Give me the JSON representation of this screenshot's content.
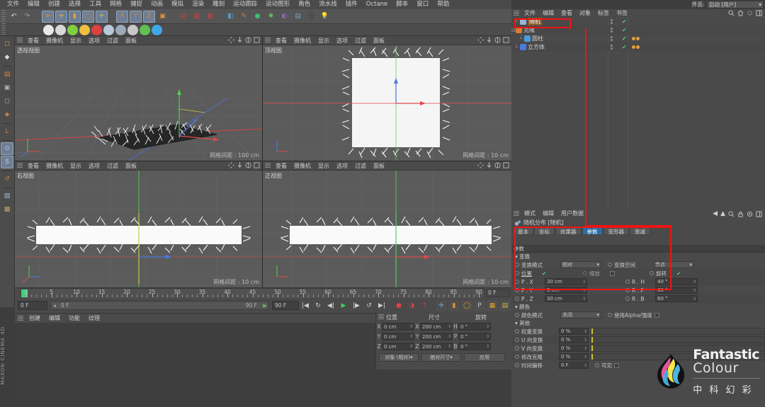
{
  "app": {
    "name": "CINEMA 4D",
    "brand_side": "MAXON CINEMA 4D"
  },
  "menubar": {
    "items": [
      "文件",
      "编辑",
      "创建",
      "选择",
      "工具",
      "网格",
      "捕捉",
      "动画",
      "模拟",
      "渲染",
      "雕刻",
      "运动跟踪",
      "运动图形",
      "角色",
      "流水线",
      "插件",
      "Octane",
      "脚本",
      "窗口",
      "帮助"
    ]
  },
  "layout_selector": {
    "label": "界面:",
    "value": "启动 [用户]"
  },
  "toolbar": {
    "items": [
      {
        "name": "undo-icon",
        "glyph": "↶"
      },
      {
        "name": "redo-icon",
        "glyph": "↷"
      },
      {
        "name": "select-live-icon",
        "glyph": "➤"
      },
      {
        "name": "move-icon",
        "glyph": "✛"
      },
      {
        "name": "scale-icon",
        "glyph": "▮"
      },
      {
        "name": "rotate-icon",
        "glyph": "◯"
      },
      {
        "name": "move-alt-icon",
        "glyph": "✛"
      },
      {
        "name": "axis-x-icon",
        "glyph": "X"
      },
      {
        "name": "axis-y-icon",
        "glyph": "Y"
      },
      {
        "name": "axis-z-icon",
        "glyph": "Z"
      },
      {
        "name": "world-coord-icon",
        "glyph": "▣"
      },
      {
        "name": "render-view-icon",
        "glyph": "▤"
      },
      {
        "name": "render-region-icon",
        "glyph": "▦"
      },
      {
        "name": "render-settings-icon",
        "glyph": "▩"
      },
      {
        "name": "cube-primitive-icon",
        "glyph": "◧"
      },
      {
        "name": "spline-pen-icon",
        "glyph": "✎"
      },
      {
        "name": "nurbs-icon",
        "glyph": "●"
      },
      {
        "name": "array-icon",
        "glyph": "✺"
      },
      {
        "name": "scene-icon",
        "glyph": "◐"
      },
      {
        "name": "deformer-icon",
        "glyph": "▤"
      },
      {
        "name": "camera-icon",
        "glyph": "🎥"
      },
      {
        "name": "light-icon",
        "glyph": "💡"
      }
    ]
  },
  "toolbar2": {
    "items": [
      {
        "name": "display-gouraud-icon",
        "glyph": "▭"
      },
      {
        "name": "display-quick-icon",
        "glyph": "◍"
      },
      {
        "name": "display-wire-icon",
        "glyph": "◉"
      },
      {
        "name": "display-sun-icon",
        "glyph": "☀"
      },
      {
        "name": "record-icon",
        "glyph": "▬"
      },
      {
        "name": "sphere-a-icon",
        "glyph": "◓"
      },
      {
        "name": "sphere-b-icon",
        "glyph": "◑"
      },
      {
        "name": "sphere-c-icon",
        "glyph": "●"
      },
      {
        "name": "green-node-icon",
        "glyph": "✿"
      },
      {
        "name": "contrast-icon",
        "glyph": "◑"
      }
    ]
  },
  "left_toolbar": {
    "items": [
      {
        "name": "model-mode-icon",
        "glyph": "◻"
      },
      {
        "name": "object-axis-icon",
        "glyph": "◆"
      },
      {
        "name": "polygon-mode-icon",
        "glyph": "▤"
      },
      {
        "name": "texture-mode-icon",
        "glyph": "▣"
      },
      {
        "name": "points-mode-icon",
        "glyph": "◻"
      },
      {
        "name": "edges-mode-icon",
        "glyph": "◈"
      },
      {
        "name": "workplane-icon",
        "glyph": "L"
      },
      {
        "name": "viewport-solo-icon",
        "glyph": "⊙"
      },
      {
        "name": "snap-icon",
        "glyph": "S"
      },
      {
        "name": "undo-view-icon",
        "glyph": "↺"
      },
      {
        "name": "lock-axis-icon",
        "glyph": "▨"
      },
      {
        "name": "quantize-icon",
        "glyph": "▩"
      }
    ]
  },
  "viewports": [
    {
      "label": "透视视图",
      "grid": "网格间距 : 100 cm",
      "menu": [
        "查看",
        "摄像机",
        "显示",
        "选项",
        "过滤",
        "面板"
      ]
    },
    {
      "label": "顶视图",
      "grid": "网格间距 : 10 cm",
      "menu": [
        "查看",
        "摄像机",
        "显示",
        "选项",
        "过滤",
        "面板"
      ]
    },
    {
      "label": "右视图",
      "grid": "网格间距 : 10 cm",
      "menu": [
        "查看",
        "摄像机",
        "显示",
        "选项",
        "过滤",
        "面板"
      ]
    },
    {
      "label": "正视图",
      "grid": "网格间距 : 10 cm",
      "menu": [
        "查看",
        "摄像机",
        "显示",
        "选项",
        "过滤",
        "面板"
      ]
    }
  ],
  "timeline": {
    "ticks": [
      0,
      5,
      10,
      15,
      20,
      25,
      30,
      35,
      40,
      45,
      50,
      55,
      60,
      65,
      70,
      75,
      80,
      85,
      90
    ],
    "current_frame": "0 F",
    "end_frame": "90 F",
    "right_frame": "0 F",
    "powerslider_value": "0 F",
    "buttons": [
      {
        "name": "goto-start-icon",
        "glyph": "|◀"
      },
      {
        "name": "loop-back-icon",
        "glyph": "↻"
      },
      {
        "name": "step-back-icon",
        "glyph": "◀|"
      },
      {
        "name": "play-icon",
        "glyph": "▶"
      },
      {
        "name": "step-forward-icon",
        "glyph": "|▶"
      },
      {
        "name": "loop-forward-icon",
        "glyph": "↺"
      },
      {
        "name": "goto-end-icon",
        "glyph": "▶|"
      },
      {
        "name": "record-keyframe-icon",
        "glyph": "●"
      },
      {
        "name": "autokey-icon",
        "glyph": "◑"
      },
      {
        "name": "keyframe-select-icon",
        "glyph": "?"
      },
      {
        "name": "position-key-icon",
        "glyph": "✛"
      },
      {
        "name": "scale-key-icon",
        "glyph": "▮"
      },
      {
        "name": "rotation-key-icon",
        "glyph": "◯"
      },
      {
        "name": "param-key-icon",
        "glyph": "P"
      },
      {
        "name": "pla-key-icon",
        "glyph": "▦"
      },
      {
        "name": "timeline-icon",
        "glyph": "▤"
      }
    ]
  },
  "material_manager": {
    "menu": [
      "创建",
      "编辑",
      "功能",
      "纹理"
    ]
  },
  "coordinates": {
    "headers": [
      "位置",
      "尺寸",
      "旋转"
    ],
    "rows": [
      {
        "pos_label": "X",
        "pos": "0 cm",
        "size_label": "X",
        "size": "200 cm",
        "rot_label": "H",
        "rot": "0 °"
      },
      {
        "pos_label": "Y",
        "pos": "0 cm",
        "size_label": "Y",
        "size": "200 cm",
        "rot_label": "P",
        "rot": "0 °"
      },
      {
        "pos_label": "Z",
        "pos": "0 cm",
        "size_label": "Z",
        "size": "200 cm",
        "rot_label": "B",
        "rot": "0 °"
      }
    ],
    "mode_dropdown": "对象 (相对)",
    "size_dropdown": "绝对尺寸",
    "apply_button": "应用"
  },
  "object_manager": {
    "menu": [
      "文件",
      "编辑",
      "查看",
      "对象",
      "标签",
      "书签"
    ],
    "icons": [
      {
        "name": "search-icon",
        "glyph": "🔍"
      },
      {
        "name": "home-icon",
        "glyph": "⌂"
      },
      {
        "name": "filter-icon",
        "glyph": "◉"
      },
      {
        "name": "layout-icon",
        "glyph": "▤"
      }
    ],
    "rows": [
      {
        "name": "随机",
        "indent": 10,
        "selected": true,
        "icon": "random-effector-icon",
        "has_tag": false
      },
      {
        "name": "克隆",
        "indent": 4,
        "selected": false,
        "icon": "cloner-icon",
        "has_tag": false
      },
      {
        "name": "圆柱",
        "indent": 16,
        "selected": false,
        "icon": "cylinder-icon",
        "has_tag": true
      },
      {
        "name": "立方体",
        "indent": 10,
        "selected": false,
        "icon": "cube-icon",
        "has_tag": true
      }
    ]
  },
  "attribute_manager": {
    "menu": [
      "模式",
      "编辑",
      "用户数据"
    ],
    "icons": [
      {
        "name": "back-arrow-icon",
        "glyph": "◀"
      },
      {
        "name": "up-arrow-icon",
        "glyph": "▲"
      },
      {
        "name": "search-icon",
        "glyph": "🔍"
      },
      {
        "name": "lock-icon",
        "glyph": "🔒"
      },
      {
        "name": "pin-icon",
        "glyph": "◎"
      },
      {
        "name": "layout-icon",
        "glyph": "▤"
      }
    ],
    "title": "随机分布 [随机]",
    "tabs": [
      {
        "label": "基本",
        "active": false
      },
      {
        "label": "坐标",
        "active": false
      },
      {
        "label": "效果器",
        "active": false
      },
      {
        "label": "参数",
        "active": true
      },
      {
        "label": "变形器",
        "active": false
      },
      {
        "label": "衰减",
        "active": false
      }
    ],
    "section_parameter": "参数",
    "group_transform": "变换",
    "transform_mode_label": "变换模式",
    "transform_mode_value": "相对",
    "transform_space_label": "变换空间",
    "transform_space_value": "节点",
    "position_label": "位置",
    "position_checked": true,
    "scale_label": "缩放",
    "scale_checked": false,
    "rotation_label": "旋转",
    "rotation_checked": true,
    "transform_rows": [
      {
        "p_label": "P . X",
        "p_value": "30 cm",
        "r_label": "R . H",
        "r_value": "40 °"
      },
      {
        "p_label": "P . Y",
        "p_value": "5 cm",
        "r_label": "R . P",
        "r_value": "60 °"
      },
      {
        "p_label": "P . Z",
        "p_value": "30 cm",
        "r_label": "R . B",
        "r_value": "60 °"
      }
    ],
    "group_color": "颜色",
    "color_mode_label": "颜色模式",
    "color_mode_value": "关闭",
    "use_alpha_label": "使用Alpha/强度",
    "group_other": "其他",
    "other_rows": [
      {
        "label": "权重变换",
        "value": "0 %"
      },
      {
        "label": "U 向变换",
        "value": "0 %"
      },
      {
        "label": "V 向变换",
        "value": "0 %"
      },
      {
        "label": "修改克隆",
        "value": "0 %"
      },
      {
        "label": "时间偏移",
        "value": "0 F"
      }
    ],
    "visible_label": "可见"
  },
  "annotations": {
    "color": "#f01414",
    "count": 3
  },
  "watermark": {
    "brand_en_1": "Fantastic",
    "brand_en_2": "Colour",
    "brand_cn": "中 科 幻 彩"
  },
  "colors": {
    "accent_blue": "#2b6ea8",
    "selection_orange": "#8a5a2a",
    "annotation_red": "#f01414",
    "panel_bg": "#4a4a4a",
    "viewport_bg": "#5a5a5a"
  }
}
